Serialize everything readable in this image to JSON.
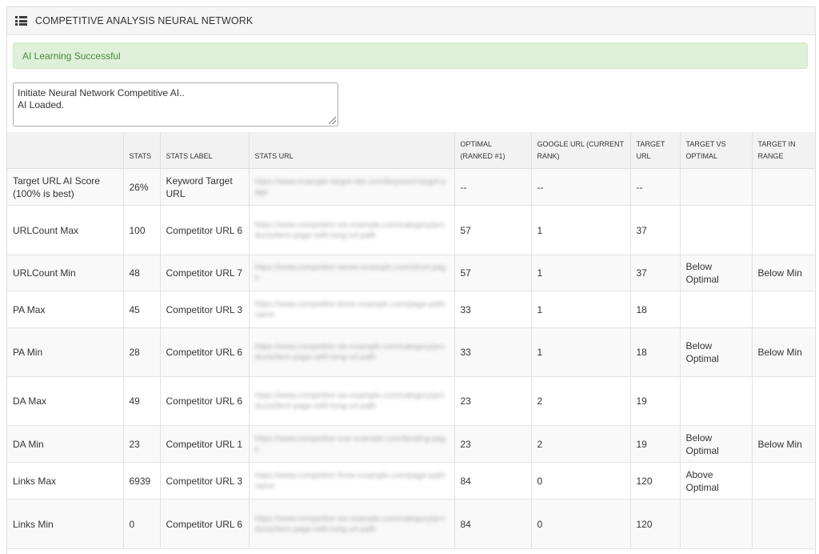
{
  "panel": {
    "icon": "list-icon",
    "title": "COMPETITIVE ANALYSIS NEURAL NETWORK"
  },
  "alert": {
    "message": "AI Learning Successful",
    "color": "#dff0d8"
  },
  "console": {
    "lines": [
      "Initiate Neural Network Competitive AI..",
      "AI Loaded."
    ]
  },
  "table": {
    "headers": [
      "",
      "STATS",
      "STATS LABEL",
      "STATS URL",
      "OPTIMAL (RANKED #1)",
      "GOOGLE URL (CURRENT RANK)",
      "TARGET URL",
      "TARGET VS OPTIMAL",
      "TARGET IN RANGE"
    ],
    "rows": [
      {
        "metric": "Target URL AI Score (100% is best)",
        "stats": "26%",
        "label": "Keyword Target URL",
        "url": "https://www.example-target-site.com/keyword-target-page",
        "optimal": "--",
        "google": "--",
        "target": "--",
        "vs_optimal": "",
        "in_range": ""
      },
      {
        "metric": "URLCount Max",
        "stats": "100",
        "label": "Competitor URL 6",
        "url": "https://www.competitor-six-example.com/category/products/item-page-with-long-url-path",
        "optimal": "57",
        "google": "1",
        "target": "37",
        "vs_optimal": "",
        "in_range": ""
      },
      {
        "metric": "URLCount Min",
        "stats": "48",
        "label": "Competitor URL 7",
        "url": "https://www.competitor-seven-example.com/short-page",
        "optimal": "57",
        "google": "1",
        "target": "37",
        "vs_optimal": "Below Optimal",
        "in_range": "Below Min"
      },
      {
        "metric": "PA Max",
        "stats": "45",
        "label": "Competitor URL 3",
        "url": "https://www.competitor-three-example.com/page-path-name",
        "optimal": "33",
        "google": "1",
        "target": "18",
        "vs_optimal": "",
        "in_range": ""
      },
      {
        "metric": "PA Min",
        "stats": "28",
        "label": "Competitor URL 6",
        "url": "https://www.competitor-six-example.com/category/products/item-page-with-long-url-path",
        "optimal": "33",
        "google": "1",
        "target": "18",
        "vs_optimal": "Below Optimal",
        "in_range": "Below Min"
      },
      {
        "metric": "DA Max",
        "stats": "49",
        "label": "Competitor URL 6",
        "url": "https://www.competitor-six-example.com/category/products/item-page-with-long-url-path",
        "optimal": "23",
        "google": "2",
        "target": "19",
        "vs_optimal": "",
        "in_range": ""
      },
      {
        "metric": "DA Min",
        "stats": "23",
        "label": "Competitor URL 1",
        "url": "https://www.competitor-one-example.com/landing-page",
        "optimal": "23",
        "google": "2",
        "target": "19",
        "vs_optimal": "Below Optimal",
        "in_range": "Below Min"
      },
      {
        "metric": "Links Max",
        "stats": "6939",
        "label": "Competitor URL 3",
        "url": "https://www.competitor-three-example.com/page-path-name",
        "optimal": "84",
        "google": "0",
        "target": "120",
        "vs_optimal": "Above Optimal",
        "in_range": ""
      },
      {
        "metric": "Links Min",
        "stats": "0",
        "label": "Competitor URL 6",
        "url": "https://www.competitor-six-example.com/category/products/item-page-with-long-url-path",
        "optimal": "84",
        "google": "0",
        "target": "120",
        "vs_optimal": "",
        "in_range": ""
      }
    ]
  }
}
